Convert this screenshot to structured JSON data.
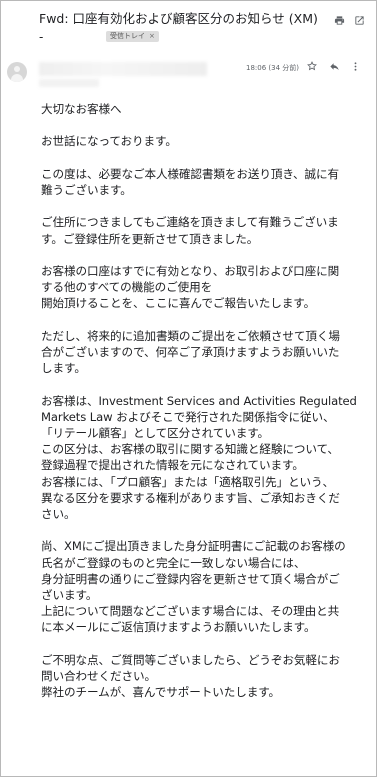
{
  "email": {
    "subject": "Fwd: 口座有効化および顧客区分のお知らせ (XM)",
    "subject_cont": "-",
    "label": "受信トレイ",
    "label_close": "×",
    "time": "18:06 (34 分前)"
  },
  "body": {
    "p1": [
      "大切なお客様へ"
    ],
    "p2": [
      "お世話になっております。"
    ],
    "p3": [
      "この度は、必要なご本人様確認書類をお送り頂き、誠に有",
      "難うございます。"
    ],
    "p4": [
      "ご住所につきましてもご連絡を頂きまして有難うございま",
      "す。ご登録住所を更新させて頂きました。"
    ],
    "p5": [
      "お客様の口座はすでに有効となり、お取引および口座に関",
      "する他のすべての機能のご使用を",
      "開始頂けることを、ここに喜んでご報告いたします。"
    ],
    "p6": [
      "ただし、将来的に追加書類のご提出をご依頼させて頂く場",
      "合がございますので、何卒ご了承頂けますようお願いいた",
      "します。"
    ],
    "p7": [
      "お客様は、Investment Services and Activities Regulated",
      "Markets Law およびそこで発行された関係指令に従い、",
      "「リテール顧客」として区分されています。",
      "この区分は、お客様の取引に関する知識と経験について、",
      "登録過程で提出された情報を元になされています。",
      "お客様には、「プロ顧客」または「適格取引先」という、",
      "異なる区分を要求する権利があります旨、ご承知おきくだ",
      "さい。"
    ],
    "p8": [
      "尚、XMにご提出頂きました身分証明書にご記載のお客様の",
      "氏名がご登録のものと完全に一致しない場合には、",
      "身分証明書の通りにご登録内容を更新させて頂く場合がご",
      "ざいます。",
      "上記について問題などございます場合には、その理由と共",
      "に本メールにご返信頂けますようお願いいたします。"
    ],
    "p9": [
      "ご不明な点、ご質問等ございましたら、どうぞお気軽にお",
      "問い合わせください。",
      "弊社のチームが、喜んでサポートいたします。"
    ]
  },
  "icons": {
    "print": "print-icon",
    "open_new": "open-in-new-icon",
    "star": "star-icon",
    "reply": "reply-icon",
    "more": "more-vert-icon",
    "avatar": "avatar-placeholder-icon"
  },
  "colors": {
    "text": "#202124",
    "muted": "#5f6368",
    "chip_bg": "#dddddd",
    "border": "#b8b8b8"
  }
}
